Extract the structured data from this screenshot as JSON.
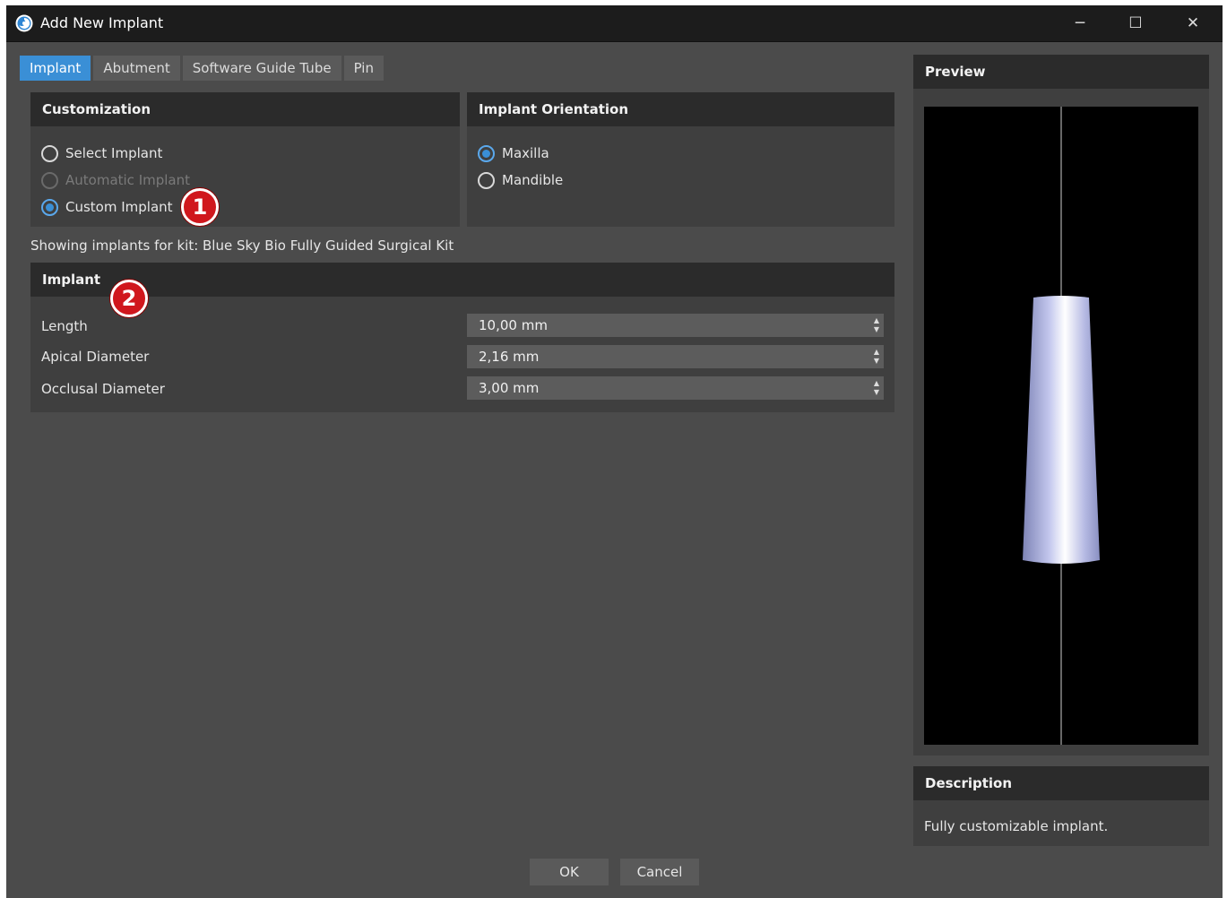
{
  "window": {
    "title": "Add New Implant",
    "controls": {
      "minimize": "─",
      "maximize": "☐",
      "close": "✕"
    }
  },
  "tabs": [
    {
      "label": "Implant",
      "active": true
    },
    {
      "label": "Abutment",
      "active": false
    },
    {
      "label": "Software Guide Tube",
      "active": false
    },
    {
      "label": "Pin",
      "active": false
    }
  ],
  "customization": {
    "header": "Customization",
    "options": [
      {
        "label": "Select Implant",
        "checked": false,
        "disabled": false
      },
      {
        "label": "Automatic Implant",
        "checked": false,
        "disabled": true
      },
      {
        "label": "Custom Implant",
        "checked": true,
        "disabled": false
      }
    ]
  },
  "orientation": {
    "header": "Implant Orientation",
    "options": [
      {
        "label": "Maxilla",
        "checked": true
      },
      {
        "label": "Mandible",
        "checked": false
      }
    ]
  },
  "kit": {
    "text": "Showing implants for kit:  Blue Sky Bio Fully Guided Surgical Kit"
  },
  "implant": {
    "header": "Implant",
    "fields": [
      {
        "label": "Length",
        "value": "10,00 mm"
      },
      {
        "label": "Apical Diameter",
        "value": "2,16 mm"
      },
      {
        "label": "Occlusal Diameter",
        "value": "3,00 mm"
      }
    ]
  },
  "callouts": [
    "1",
    "2"
  ],
  "preview": {
    "header": "Preview"
  },
  "description": {
    "header": "Description",
    "text": "Fully customizable implant."
  },
  "buttons": {
    "ok": "OK",
    "cancel": "Cancel"
  },
  "colors": {
    "accent": "#3a8fd6",
    "callout": "#d0171d",
    "background": "#4b4b4b"
  }
}
